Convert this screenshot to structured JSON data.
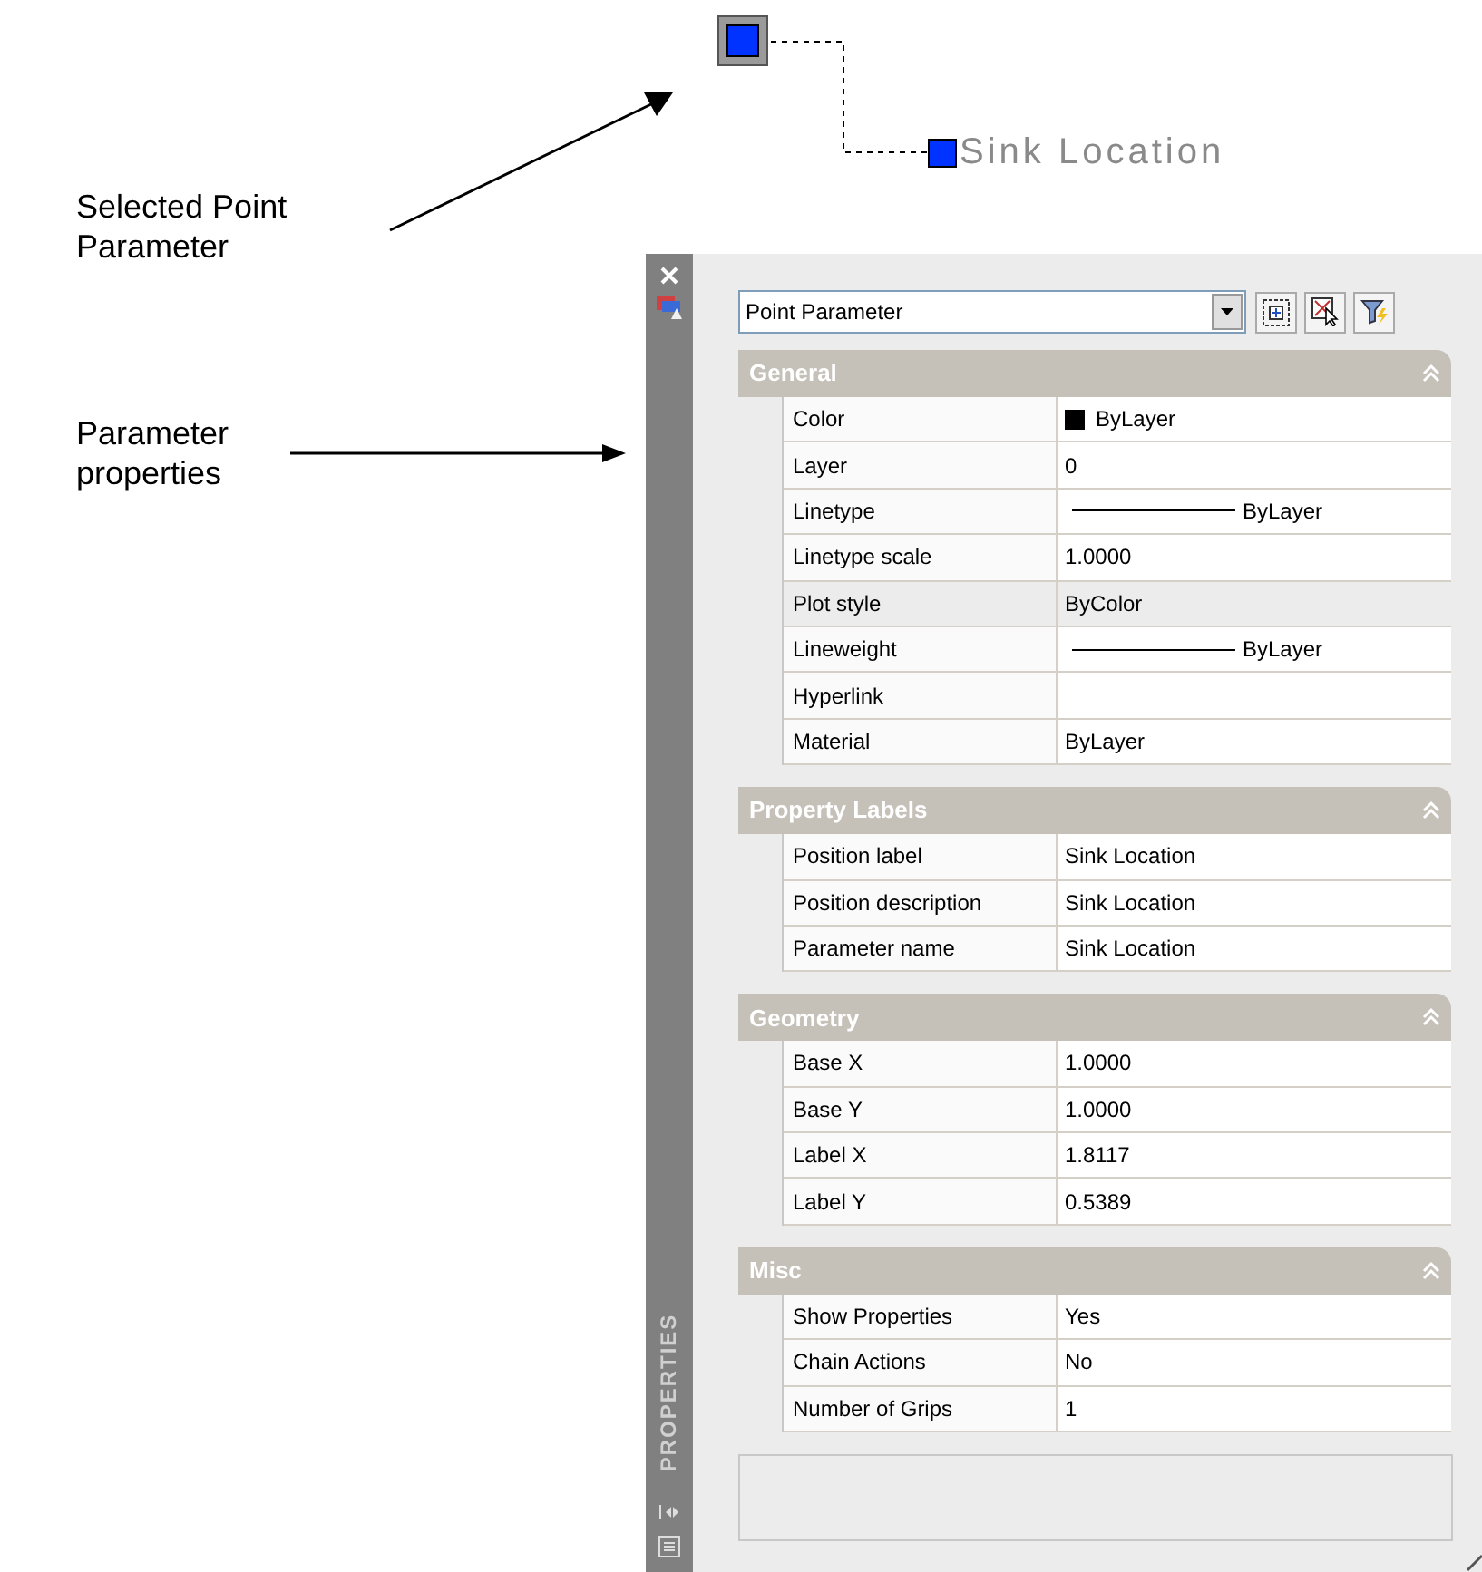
{
  "annotations": [
    {
      "text": "Selected Point Parameter"
    },
    {
      "text": "Parameter properties"
    }
  ],
  "drawing": {
    "label": "Sink Location"
  },
  "palette": {
    "title": "PROPERTIES",
    "object_type": "Point Parameter",
    "sections": [
      {
        "title": "General",
        "expanded": true,
        "rows": [
          {
            "name": "Color",
            "kind": "color",
            "color": "#000000",
            "value": "ByLayer",
            "selected": false
          },
          {
            "name": "Layer",
            "kind": "text",
            "value": "0",
            "selected": false
          },
          {
            "name": "Linetype",
            "kind": "line",
            "value": "ByLayer",
            "selected": false
          },
          {
            "name": "Linetype scale",
            "kind": "text",
            "value": "1.0000",
            "selected": false
          },
          {
            "name": "Plot style",
            "kind": "text",
            "value": "ByColor",
            "selected": true
          },
          {
            "name": "Lineweight",
            "kind": "line",
            "value": "ByLayer",
            "selected": false
          },
          {
            "name": "Hyperlink",
            "kind": "text",
            "selected": false
          },
          {
            "name": "Material",
            "kind": "text",
            "value": "ByLayer",
            "selected": false
          }
        ]
      },
      {
        "title": "Property Labels",
        "expanded": true,
        "rows": [
          {
            "name": "Position label",
            "kind": "text",
            "value": "Sink Location",
            "selected": false
          },
          {
            "name": "Position description",
            "kind": "text",
            "value": "Sink Location",
            "selected": false
          },
          {
            "name": "Parameter name",
            "kind": "text",
            "value": "Sink Location",
            "selected": false
          }
        ]
      },
      {
        "title": "Geometry",
        "expanded": true,
        "rows": [
          {
            "name": "Base X",
            "kind": "text",
            "value": "1.0000",
            "selected": false
          },
          {
            "name": "Base Y",
            "kind": "text",
            "value": "1.0000",
            "selected": false
          },
          {
            "name": "Label X",
            "kind": "text",
            "value": "1.8117",
            "selected": false
          },
          {
            "name": "Label Y",
            "kind": "text",
            "value": "0.5389",
            "selected": false
          }
        ]
      },
      {
        "title": "Misc",
        "expanded": true,
        "rows": [
          {
            "name": "Show Properties",
            "kind": "text",
            "value": "Yes",
            "selected": false
          },
          {
            "name": "Chain Actions",
            "kind": "text",
            "value": "No",
            "selected": false
          },
          {
            "name": "Number of Grips",
            "kind": "text",
            "value": "1",
            "selected": false
          }
        ]
      }
    ]
  }
}
